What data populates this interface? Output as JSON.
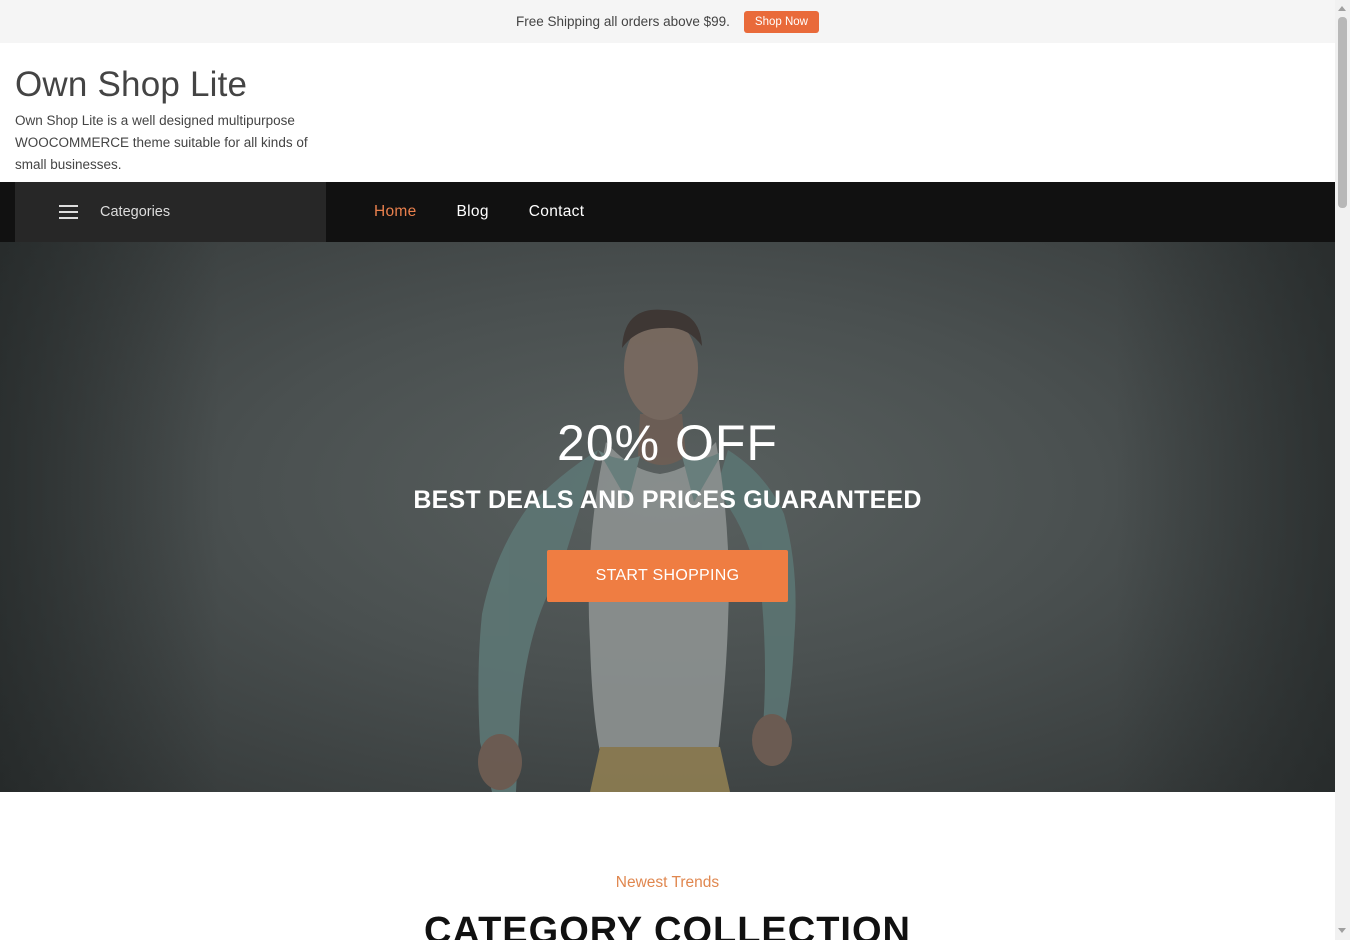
{
  "topbar": {
    "text": "Free Shipping all orders above $99.",
    "button_label": "Shop Now"
  },
  "header": {
    "site_title": "Own Shop Lite",
    "site_description": "Own Shop Lite is a well designed multipurpose WOOCOMMERCE theme suitable for all kinds of small businesses."
  },
  "nav": {
    "categories_label": "Categories",
    "items": [
      {
        "label": "Home",
        "active": true
      },
      {
        "label": "Blog",
        "active": false
      },
      {
        "label": "Contact",
        "active": false
      }
    ]
  },
  "hero": {
    "title": "20% OFF",
    "subtitle": "BEST DEALS AND PRICES GUARANTEED",
    "button_label": "START SHOPPING"
  },
  "trends": {
    "kicker": "Newest Trends",
    "title": "CATEGORY COLLECTION"
  },
  "colors": {
    "accent": "#ef7d42",
    "nav_active": "#e9804d",
    "nav_background": "#111111",
    "categories_background": "#272727",
    "topbar_background": "#f5f5f5"
  },
  "icons": {
    "menu": "hamburger-icon"
  }
}
